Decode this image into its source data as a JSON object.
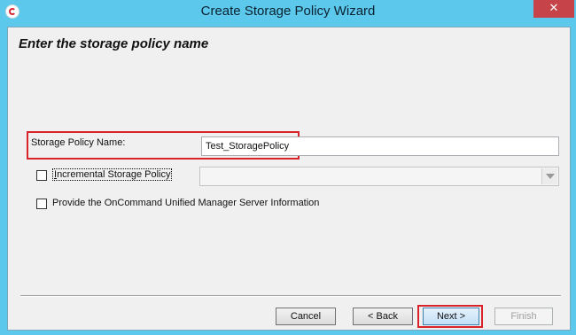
{
  "window": {
    "title": "Create Storage Policy Wizard",
    "close_glyph": "✕"
  },
  "page": {
    "heading": "Enter the storage policy name"
  },
  "form": {
    "name_label": "Storage Policy Name:",
    "name_value": "Test_StoragePolicy",
    "incremental_label_first": "I",
    "incremental_label_rest": "ncremental Storage Policy",
    "incremental_checked": false,
    "oncommand_label": "Provide the OnCommand Unified Manager Server Information",
    "oncommand_checked": false,
    "combo_value": ""
  },
  "buttons": {
    "cancel": "Cancel",
    "back": "< Back",
    "next": "Next >",
    "finish": "Finish"
  },
  "colors": {
    "title_bar": "#5bc8ec",
    "close_button": "#c7434a",
    "highlight": "#d9232a",
    "client_bg": "#f0f0f0"
  },
  "icons": {
    "app": "app-icon",
    "close": "close-icon",
    "dropdown": "chevron-down-icon"
  }
}
